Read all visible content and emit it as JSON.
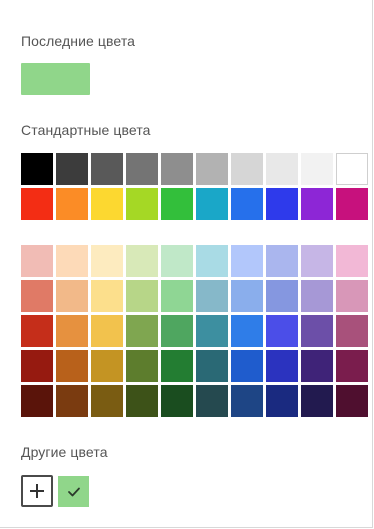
{
  "recent": {
    "title": "Последние цвета",
    "colors": [
      "#90d68a"
    ]
  },
  "standard": {
    "title": "Стандартные цвета",
    "rows": [
      [
        "#000000",
        "#3c3c3c",
        "#595959",
        "#747474",
        "#8e8e8e",
        "#b2b2b2",
        "#d6d6d6",
        "#e8e8e8",
        "#f2f2f2",
        "#ffffff"
      ],
      [
        "#f32d14",
        "#fb8c26",
        "#fcd830",
        "#a5d825",
        "#33bf3b",
        "#1aa7c8",
        "#2670eb",
        "#2e3aeb",
        "#8d26d6",
        "#c7117d"
      ]
    ]
  },
  "palette": {
    "rows": [
      [
        "#f1bcb5",
        "#fddab8",
        "#fdebbf",
        "#d8e9b8",
        "#c0e8c8",
        "#a9dbe5",
        "#b2c7fb",
        "#aab6ee",
        "#c6b6e6",
        "#f2b8d6"
      ],
      [
        "#e07a66",
        "#f2b989",
        "#fcdf8c",
        "#b7d688",
        "#8fd694",
        "#86b8c9",
        "#8aaeec",
        "#8597e0",
        "#a698d6",
        "#d897b8"
      ],
      [
        "#c52e1a",
        "#e6913f",
        "#f2c24d",
        "#7fa650",
        "#4fa660",
        "#3d8fa0",
        "#2f7de8",
        "#4b4ee8",
        "#6c4fa8",
        "#a8517b"
      ],
      [
        "#961a10",
        "#b8611b",
        "#c49423",
        "#5d7d2d",
        "#237d32",
        "#2a6975",
        "#1f5ccd",
        "#2b33bf",
        "#3f2378",
        "#7a1d4d"
      ],
      [
        "#5a140a",
        "#7a3b10",
        "#7a5c12",
        "#3d5218",
        "#1a4d1f",
        "#25494f",
        "#1e4585",
        "#1a2a80",
        "#221a4f",
        "#4f0f2f"
      ]
    ]
  },
  "other": {
    "title": "Другие цвета",
    "add_icon": "plus-icon",
    "custom_colors": [
      "#90d68a"
    ],
    "check_icon": "checkmark-icon",
    "check_color": "#2b3a2b"
  }
}
